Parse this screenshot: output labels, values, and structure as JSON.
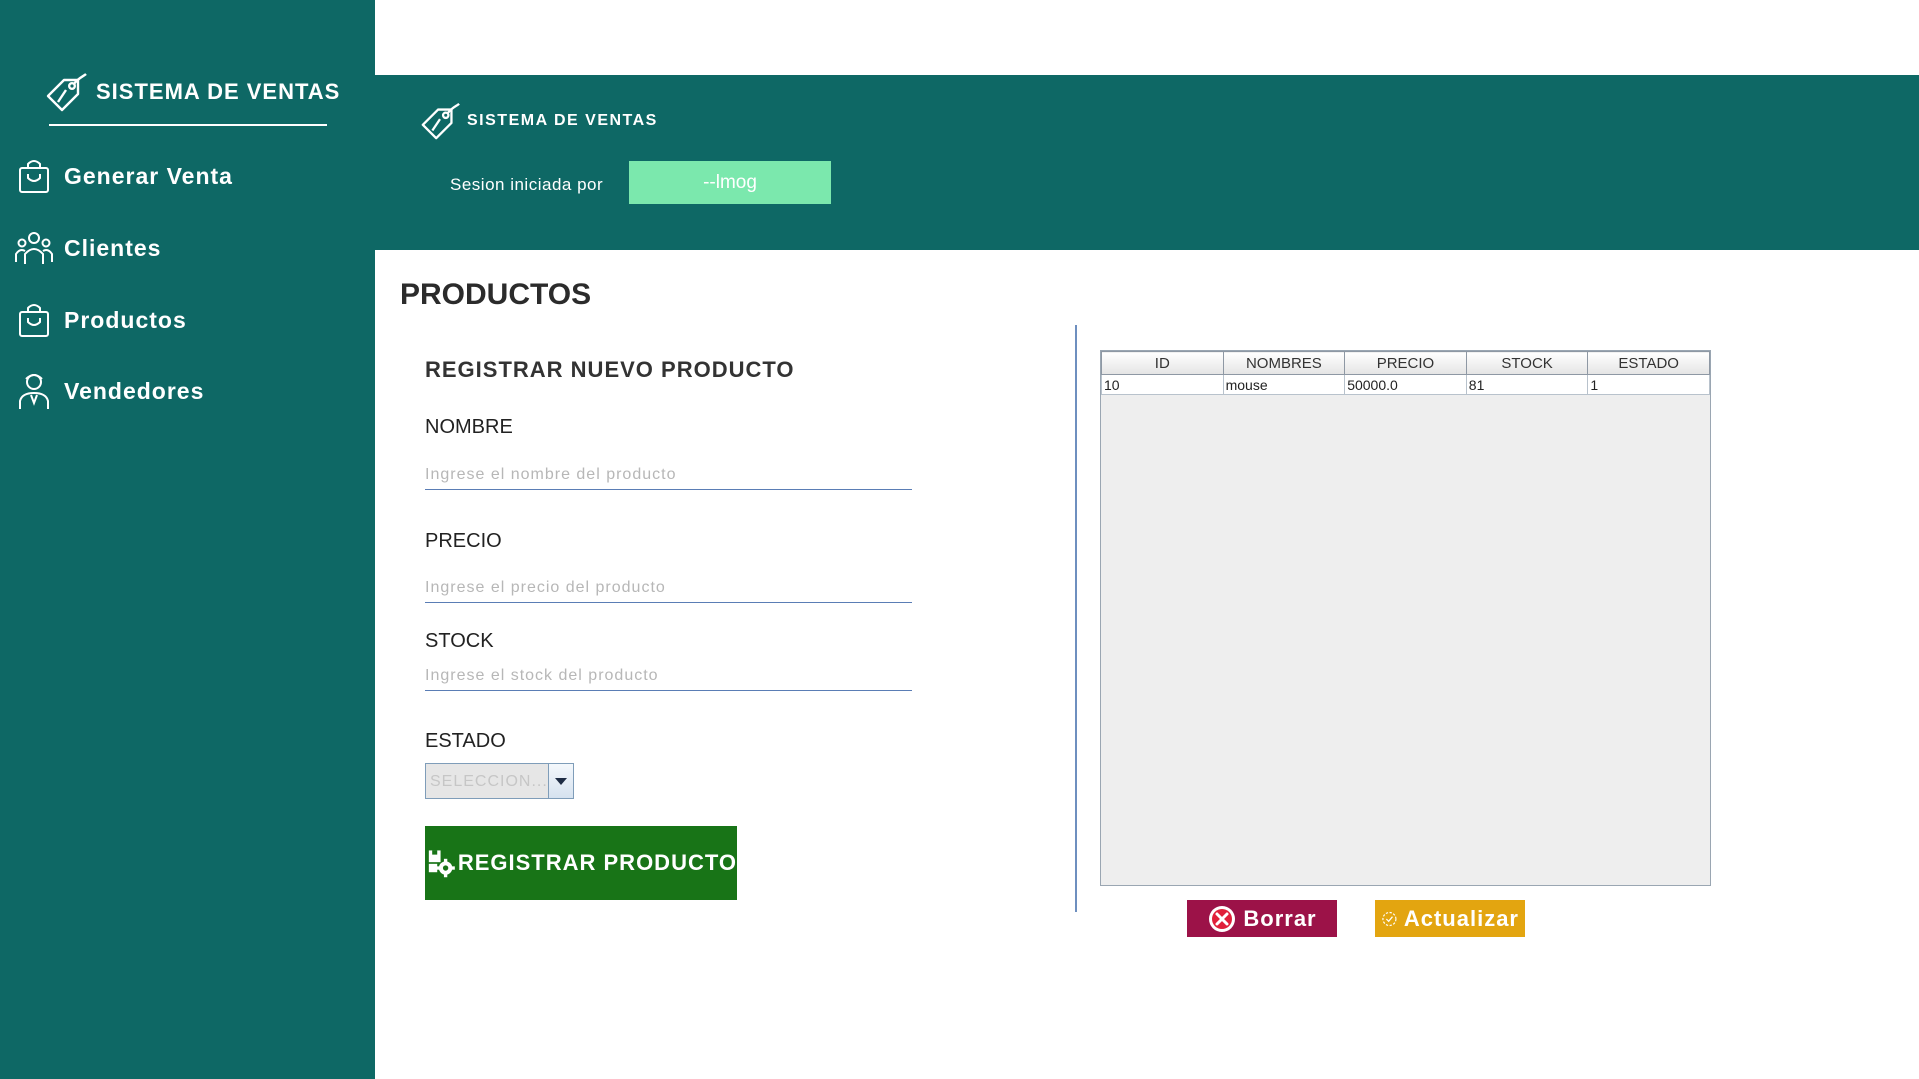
{
  "sidebar": {
    "brand": "SISTEMA DE VENTAS",
    "items": [
      {
        "label": "Generar Venta",
        "icon": "shopping-bag-icon"
      },
      {
        "label": "Clientes",
        "icon": "group-icon"
      },
      {
        "label": "Productos",
        "icon": "shopping-bag-icon"
      },
      {
        "label": "Vendedores",
        "icon": "seller-icon"
      }
    ]
  },
  "header": {
    "brand": "SISTEMA DE VENTAS",
    "session_label": "Sesion iniciada por",
    "session_user": "--lmog"
  },
  "page": {
    "title": "PRODUCTOS"
  },
  "form": {
    "title": "REGISTRAR NUEVO PRODUCTO",
    "nombre": {
      "label": "NOMBRE",
      "placeholder": "Ingrese el nombre del producto"
    },
    "precio": {
      "label": "PRECIO",
      "placeholder": "Ingrese el precio del producto"
    },
    "stock": {
      "label": "STOCK",
      "placeholder": "Ingrese el stock del producto"
    },
    "estado": {
      "label": "ESTADO",
      "selected": "SELECCION..."
    },
    "submit_label": "REGISTRAR PRODUCTO"
  },
  "table": {
    "columns": [
      "ID",
      "NOMBRES",
      "PRECIO",
      "STOCK",
      "ESTADO"
    ],
    "rows": [
      [
        "10",
        "mouse",
        "50000.0",
        "81",
        "1"
      ]
    ]
  },
  "actions": {
    "delete_label": "Borrar",
    "update_label": "Actualizar"
  },
  "colors": {
    "primary": "#0e6865",
    "session_box": "#7be8ad",
    "register": "#187417",
    "delete": "#9c1248",
    "update": "#e3a510"
  }
}
